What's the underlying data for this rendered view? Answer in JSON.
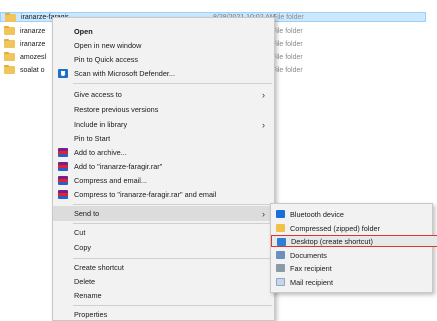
{
  "files": [
    {
      "name": "iranarze-faragir",
      "date": "8/28/2021 10:02 AM",
      "type": "File folder",
      "selected": true
    },
    {
      "name": "iranarze",
      "date": "",
      "type": "File folder",
      "selected": false
    },
    {
      "name": "iranarze",
      "date": "",
      "type": "File folder",
      "selected": false
    },
    {
      "name": "amozesl",
      "date": "",
      "type": "File folder",
      "selected": false
    },
    {
      "name": "soalat o",
      "date": "",
      "type": "File folder",
      "selected": false
    }
  ],
  "menu": {
    "open": "Open",
    "open_new_window": "Open in new window",
    "pin_quick_access": "Pin to Quick access",
    "scan_defender": "Scan with Microsoft Defender...",
    "give_access": "Give access to",
    "restore_versions": "Restore previous versions",
    "include_library": "Include in library",
    "pin_start": "Pin to Start",
    "add_archive": "Add to archive...",
    "add_rar": "Add to \"iranarze-faragir.rar\"",
    "compress_email": "Compress and email...",
    "compress_rar_email": "Compress to \"iranarze-faragir.rar\" and email",
    "send_to": "Send to",
    "cut": "Cut",
    "copy": "Copy",
    "create_shortcut": "Create shortcut",
    "delete": "Delete",
    "rename": "Rename",
    "properties": "Properties"
  },
  "submenu": {
    "bluetooth": "Bluetooth device",
    "compressed": "Compressed (zipped) folder",
    "desktop": "Desktop (create shortcut)",
    "documents": "Documents",
    "fax": "Fax recipient",
    "mail": "Mail recipient"
  },
  "icons": {
    "folder": "folder-icon",
    "defender": "defender-shield-icon",
    "winrar": "winrar-icon",
    "arrow": "chevron-right-icon"
  },
  "colors": {
    "selection": "#cce8ff",
    "focus_outline": "#e03434",
    "menu_bg": "#f2f2f2"
  }
}
